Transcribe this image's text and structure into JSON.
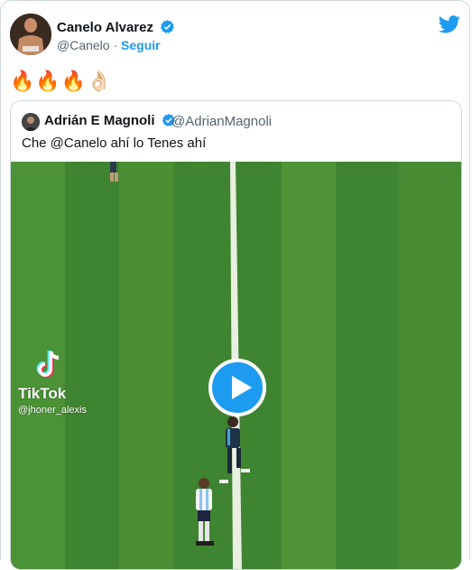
{
  "tweet": {
    "author_name": "Canelo Alvarez",
    "handle": "@Canelo",
    "separator": "·",
    "follow_label": "Seguir",
    "text": "🔥🔥🔥👌🏻"
  },
  "quoted": {
    "author_name": "Adrián E Magnoli",
    "handle": "@AdrianMagnoli",
    "text": "Che @Canelo  ahí lo Tenes  ahí"
  },
  "video": {
    "watermark_brand": "TikTok",
    "watermark_user": "@jhoner_alexis"
  },
  "colors": {
    "accent": "#1d9bf0",
    "pitch_dark": "#3e7f2c",
    "pitch_light": "#4f9436"
  },
  "icons": [
    "verified-icon",
    "twitter-bird-icon",
    "play-icon",
    "tiktok-logo-icon"
  ]
}
